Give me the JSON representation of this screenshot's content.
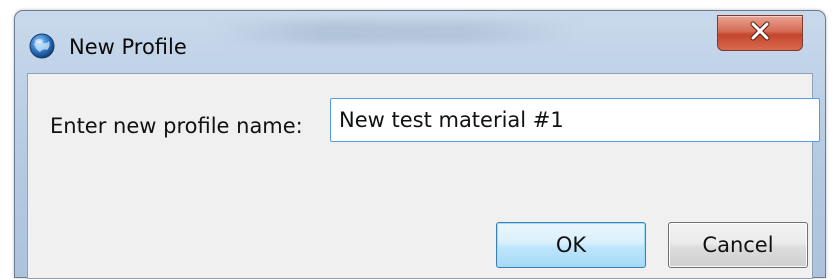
{
  "window": {
    "title": "New Profile",
    "icons": {
      "app": "globe-app-icon",
      "close": "close-icon"
    }
  },
  "form": {
    "label": "Enter new profile name:",
    "profile_name_value": "New test material #1"
  },
  "buttons": {
    "ok_label": "OK",
    "cancel_label": "Cancel"
  },
  "colors": {
    "frame": "#b7cbe2",
    "client": "#f0f0f0",
    "close_button": "#c4452d",
    "default_button_border": "#3c7fb1"
  }
}
